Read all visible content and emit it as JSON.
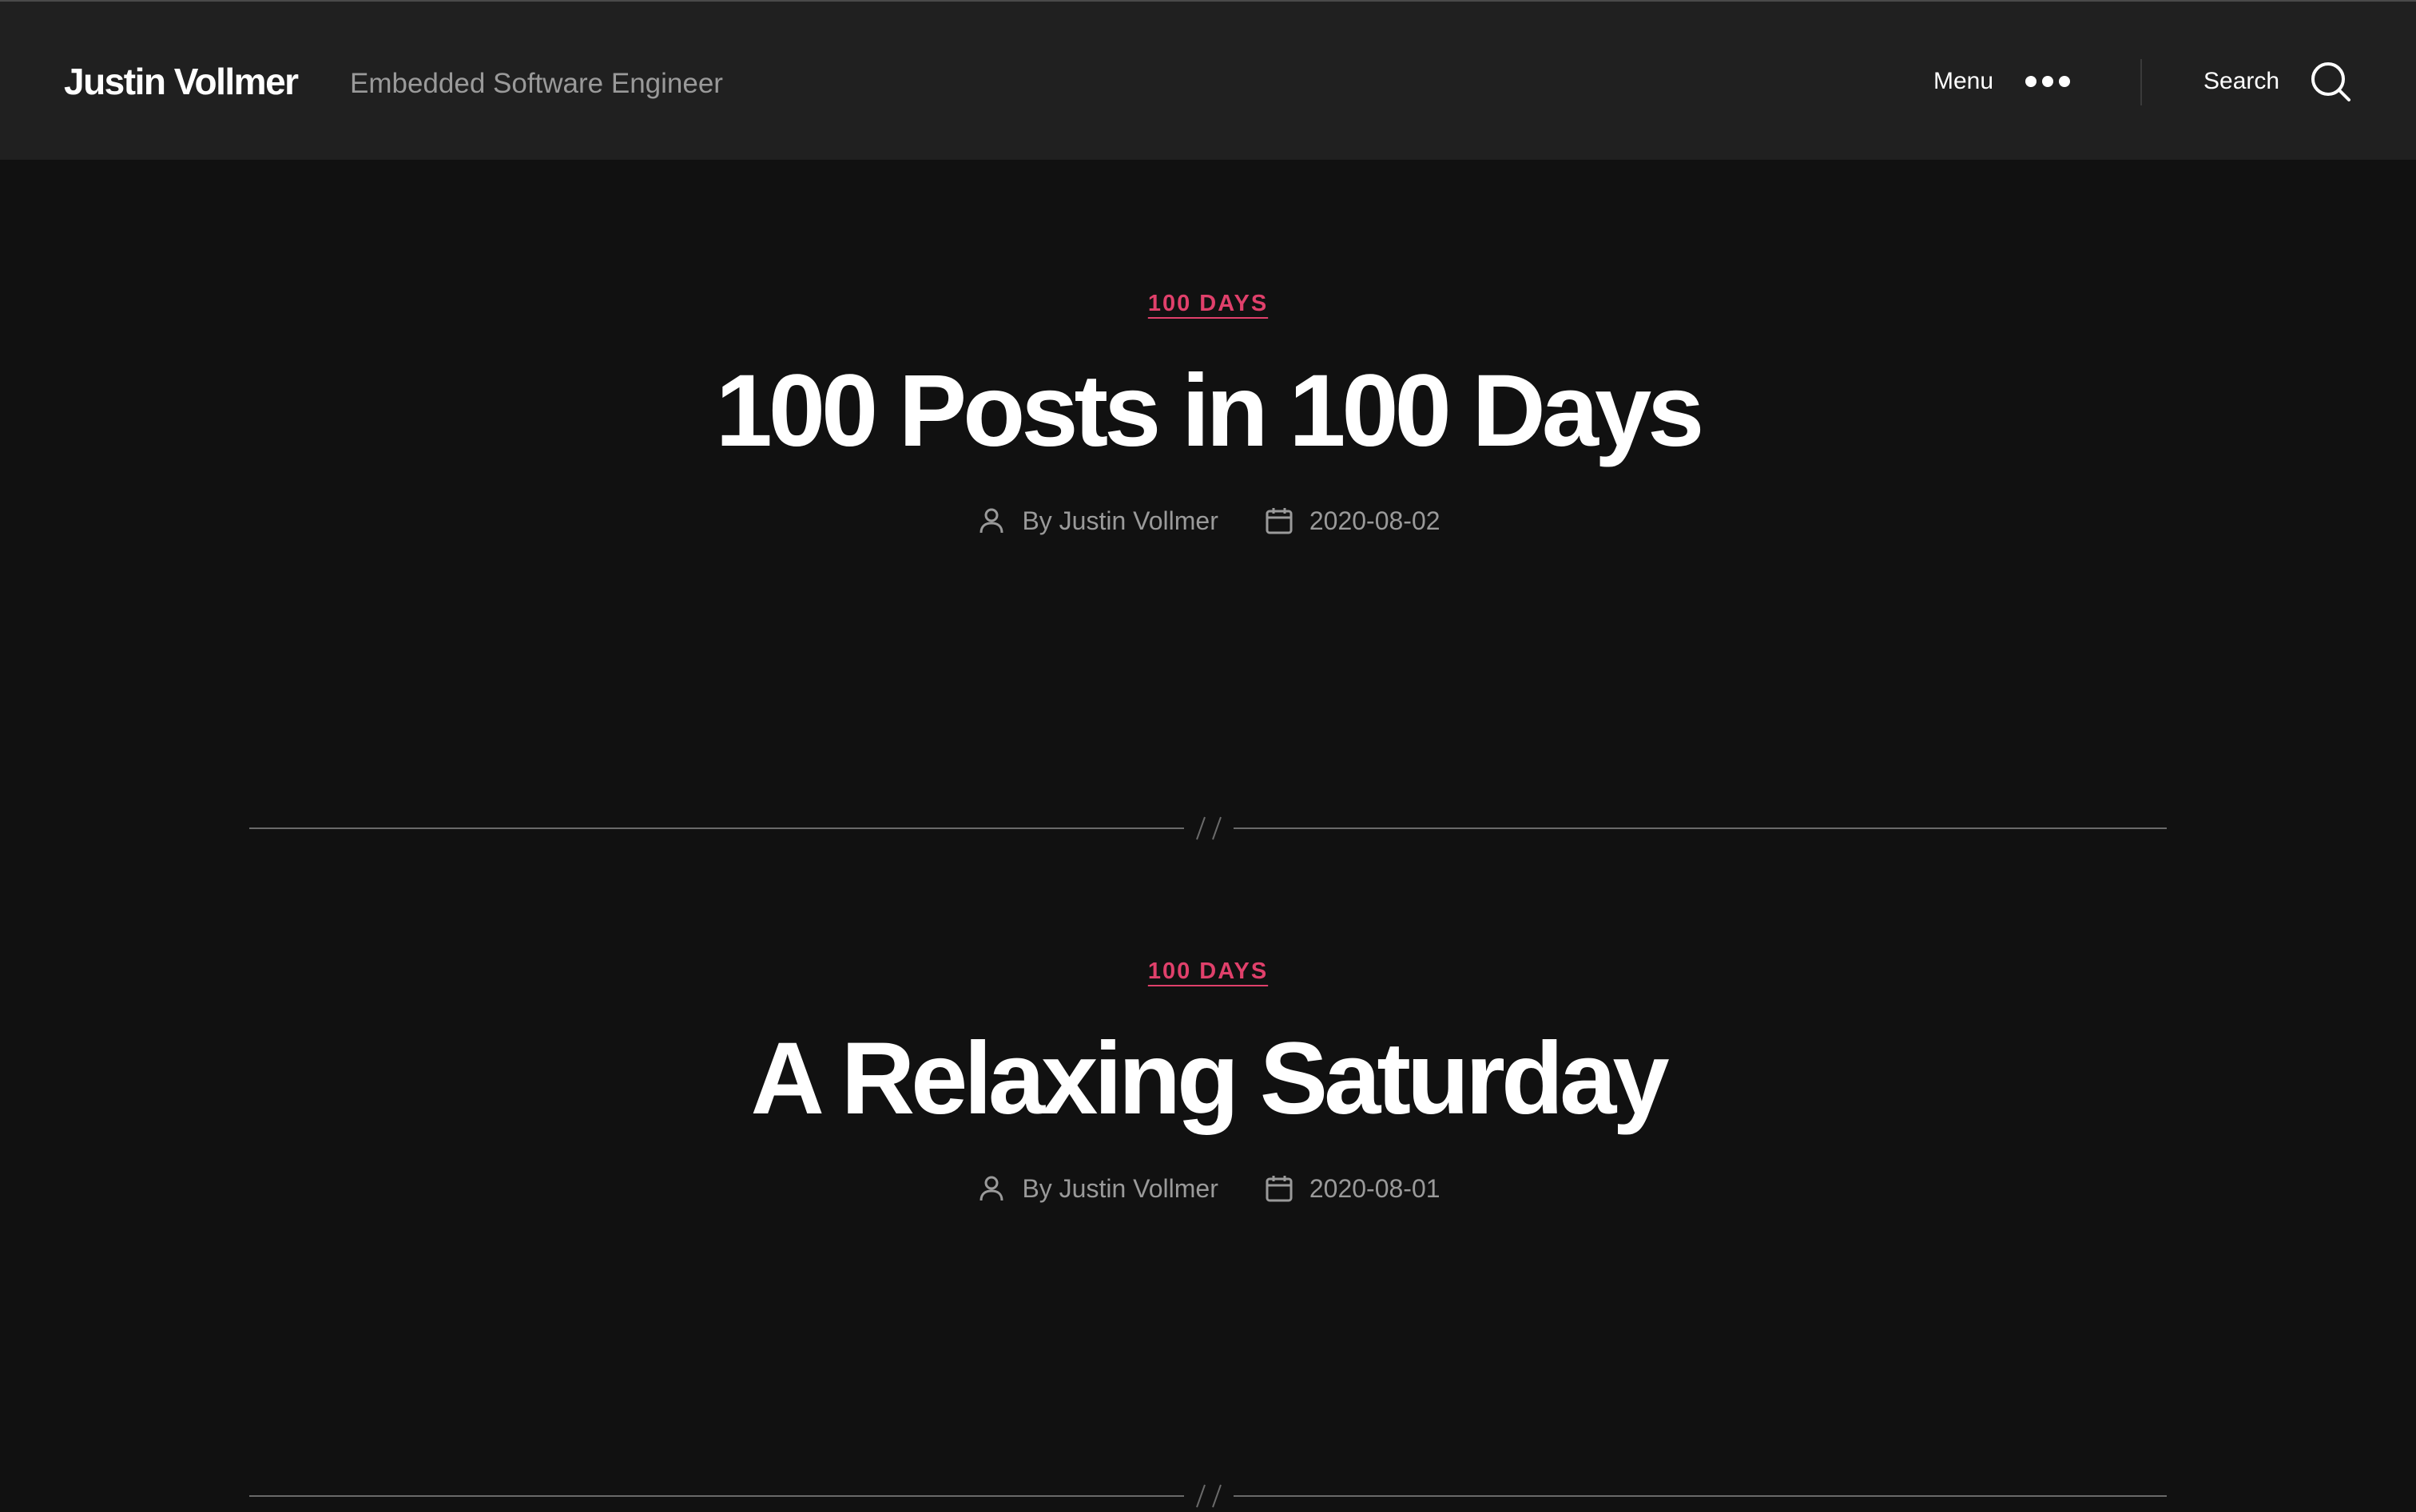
{
  "header": {
    "site_title": "Justin Vollmer",
    "site_description": "Embedded Software Engineer",
    "menu_label": "Menu",
    "menu_icon": "horizontal-dots-icon",
    "search_label": "Search",
    "search_icon": "search-icon"
  },
  "posts": [
    {
      "category": "100 DAYS",
      "title": "100 Posts in 100 Days",
      "author": "By Justin Vollmer",
      "date": "2020-08-02"
    },
    {
      "category": "100 DAYS",
      "title": "A Relaxing Saturday",
      "author": "By Justin Vollmer",
      "date": "2020-08-01"
    }
  ],
  "colors": {
    "background": "#111111",
    "header_background": "#202020",
    "accent": "#e0406b",
    "meta_text": "#9a9a9a",
    "title_text": "#ffffff"
  }
}
